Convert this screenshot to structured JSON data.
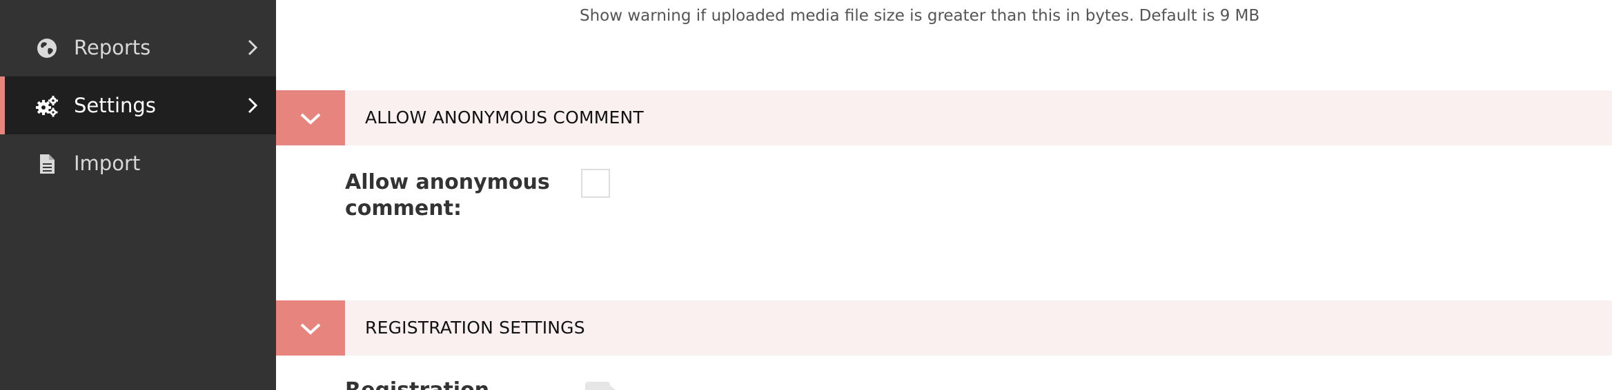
{
  "sidebar": {
    "items": [
      {
        "label": "Reports",
        "icon": "globe-icon",
        "active": false
      },
      {
        "label": "Settings",
        "icon": "gears-icon",
        "active": true
      },
      {
        "label": "Import",
        "icon": "file-icon",
        "active": false
      }
    ]
  },
  "main": {
    "help_text": "Show warning if uploaded media file size is greater than this in bytes. Default is 9 MB",
    "sections": [
      {
        "title": "ALLOW ANONYMOUS COMMENT",
        "fields": [
          {
            "label": "Allow anonymous comment:",
            "checked": false
          }
        ]
      },
      {
        "title": "REGISTRATION SETTINGS",
        "fields": [
          {
            "label": "Registration"
          }
        ]
      }
    ]
  },
  "colors": {
    "sidebar_bg": "#333333",
    "sidebar_active_bg": "#1f1f1f",
    "accent": "#e5857d",
    "section_header_bg": "#fbf0f0"
  }
}
